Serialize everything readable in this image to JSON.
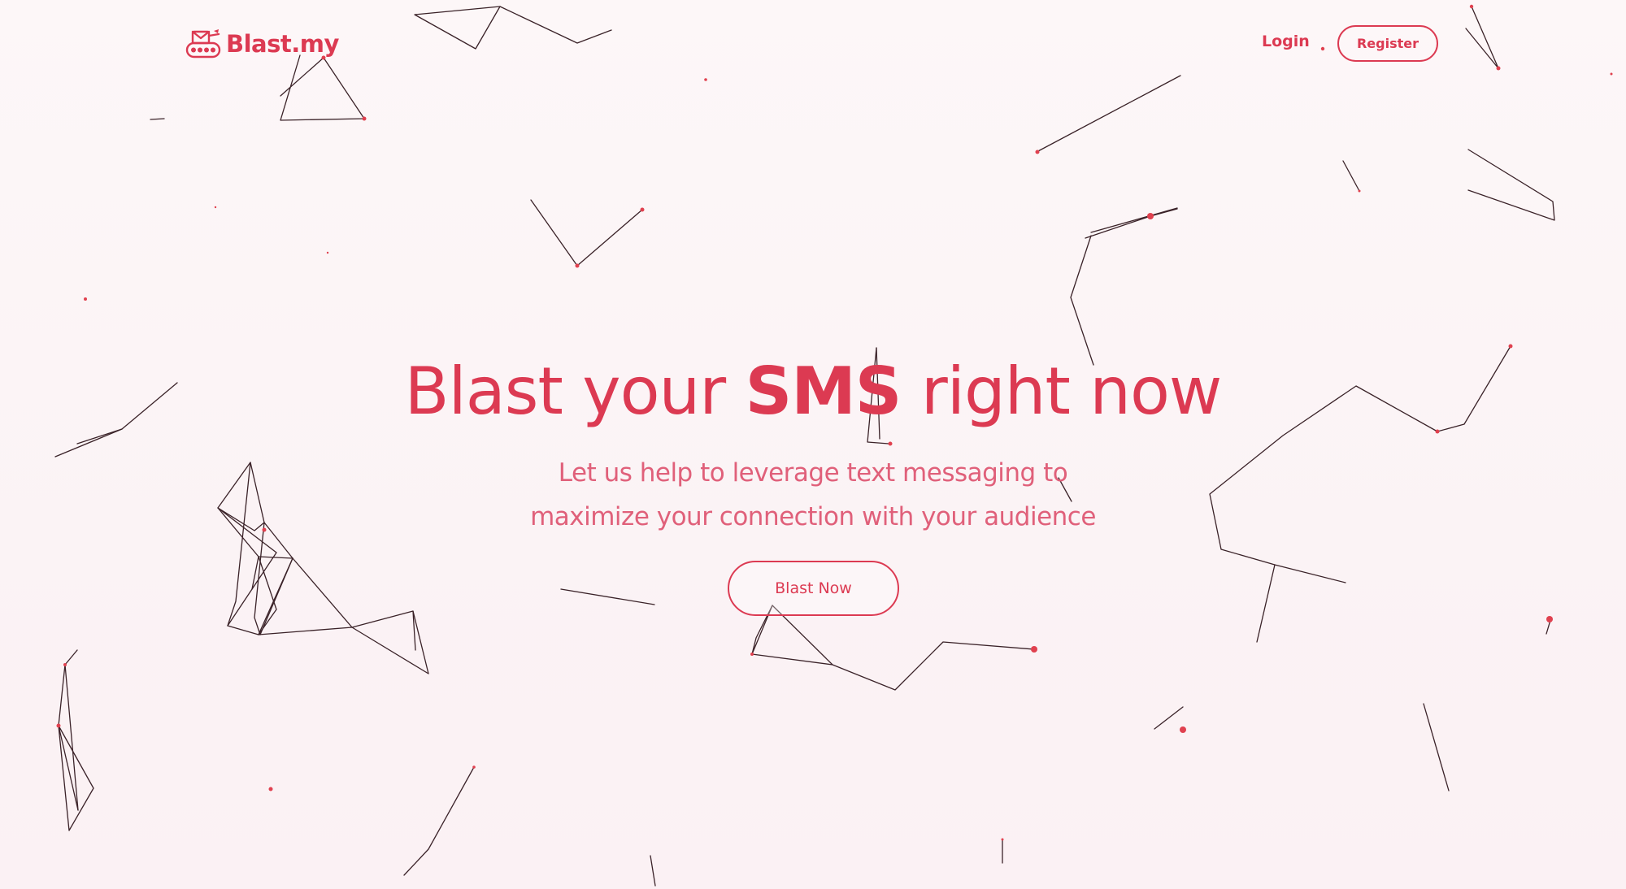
{
  "brand": {
    "name": "Blast.my",
    "accent_color": "#dc3a52",
    "logo_icon": "tank-mail-icon"
  },
  "nav": {
    "login_label": "Login",
    "register_label": "Register"
  },
  "hero": {
    "title_prefix": "Blast your",
    "title_highlight": "SMS",
    "title_suffix": "right now",
    "subtitle_line1": "Let us help to leverage text messaging to",
    "subtitle_line2": "maximize your connection with your audience",
    "cta_label": "Blast Now"
  },
  "background": {
    "type": "particle-network",
    "line_color": "#3a2228",
    "dot_color": "#e0414f"
  }
}
